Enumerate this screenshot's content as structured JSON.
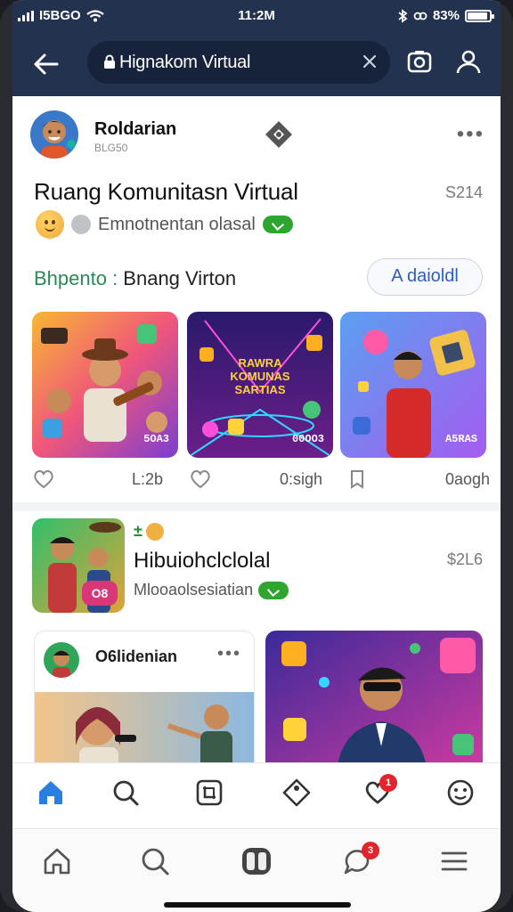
{
  "status_bar": {
    "carrier": "I5BGO",
    "time": "11:2M",
    "battery": "83%",
    "battery_level": 0.83
  },
  "top_nav": {
    "url_text": "Hignakom Virtual"
  },
  "post": {
    "author": "Roldarian",
    "author_sub": "BLG50",
    "title": "Ruang Komunitasn Virtual",
    "count": "S214",
    "reaction_text": "Emnotnentan olasal",
    "section_label_accent": "Bhpento :",
    "section_label_rest": " Bnang Virton",
    "follow_label": "A daioldl",
    "media": [
      {
        "tag": "5OA3"
      },
      {
        "tag": "00OO3",
        "overlay": [
          "RAWRA",
          "KOMUNAS",
          "SARTIAS"
        ]
      },
      {
        "tag": "A5RAS"
      }
    ],
    "stats": [
      "L:2b",
      "0:sigh",
      "0aogh"
    ]
  },
  "item2": {
    "badge_glyph": "±",
    "title": "Hibuiohclclolal",
    "count": "$2L6",
    "sub": "Mlooaolsesiatian",
    "thumb_pill": "O8"
  },
  "card3": {
    "name": "O6lidenian"
  },
  "tab_bar": {
    "likes_badge": "1"
  },
  "sys_bar": {
    "chat_badge": "3"
  },
  "colors": {
    "nav_bg": "#22324f",
    "accent_blue": "#2a7de1",
    "accent_green": "#2fa52f",
    "badge_red": "#e0252c"
  },
  "icons": [
    "back-arrow-icon",
    "lock-icon",
    "close-icon",
    "camera-icon",
    "account-icon",
    "more-icon",
    "heart-icon",
    "bookmark-icon",
    "home-icon",
    "search-icon",
    "crop-icon",
    "tag-icon",
    "smile-icon",
    "menu-icon",
    "game-icon",
    "chat-icon"
  ]
}
